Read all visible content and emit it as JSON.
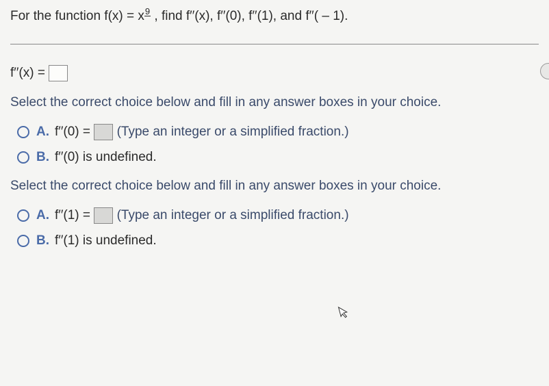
{
  "question": {
    "prefix": "For the function f(x) = x",
    "exponent_display": "9",
    "suffix": " , find f′′(x), f′′(0), f′′(1), and f′′( – 1)."
  },
  "answer_prompt": "f′′(x) =",
  "instruction1": "Select the correct choice below and fill in any answer boxes in your choice.",
  "group1": {
    "a_label": "A.",
    "a_text": "f′′(0) =",
    "a_hint": "(Type an integer or a simplified fraction.)",
    "b_label": "B.",
    "b_text": "f′′(0) is undefined."
  },
  "instruction2": "Select the correct choice below and fill in any answer boxes in your choice.",
  "group2": {
    "a_label": "A.",
    "a_text": "f′′(1) =",
    "a_hint": "(Type an integer or a simplified fraction.)",
    "b_label": "B.",
    "b_text": "f′′(1) is undefined."
  }
}
